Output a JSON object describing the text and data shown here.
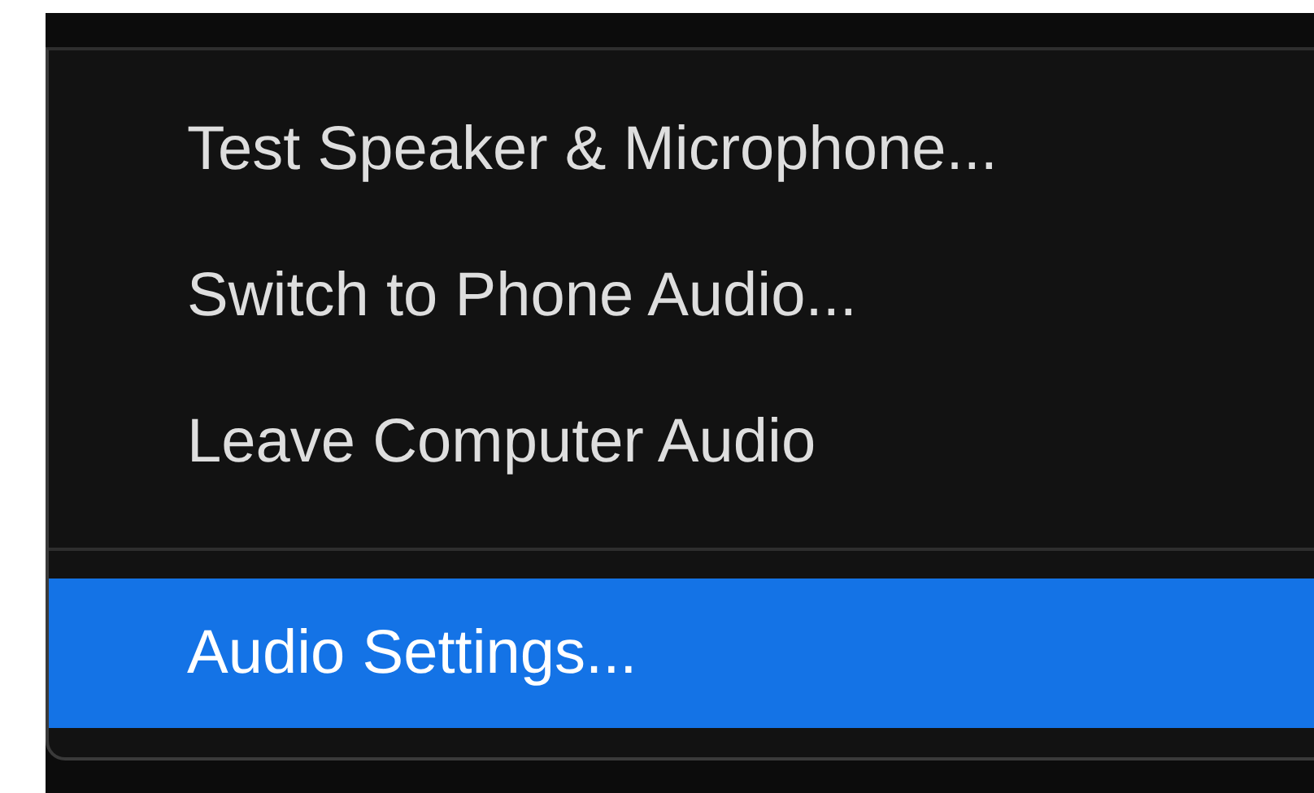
{
  "menu": {
    "sections": [
      {
        "items": [
          {
            "label": "Test Speaker & Microphone...",
            "selected": false
          },
          {
            "label": "Switch to Phone Audio...",
            "selected": false
          },
          {
            "label": "Leave Computer Audio",
            "selected": false
          }
        ]
      },
      {
        "items": [
          {
            "label": "Audio Settings...",
            "selected": true
          }
        ]
      }
    ]
  }
}
